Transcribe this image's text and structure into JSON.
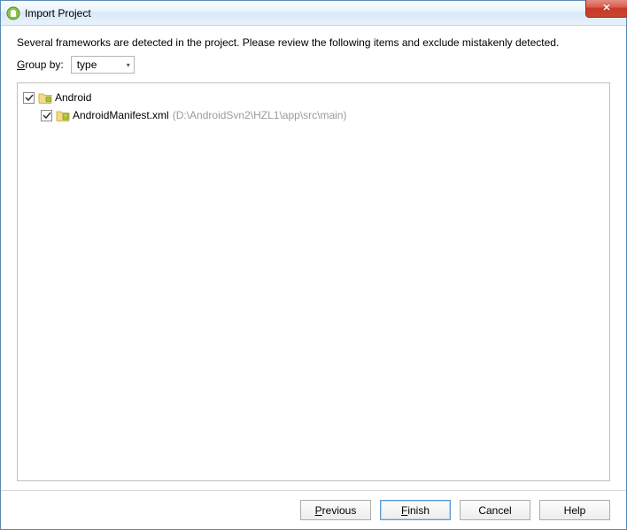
{
  "window": {
    "title": "Import Project"
  },
  "content": {
    "description": "Several frameworks are detected in the project. Please review the following items and exclude mistakenly detected.",
    "groupby_label_prefix": "",
    "groupby_label_mnemonic": "G",
    "groupby_label_suffix": "roup by:",
    "groupby_value": "type"
  },
  "tree": {
    "root": {
      "checked": true,
      "label": "Android"
    },
    "child": {
      "checked": true,
      "label": "AndroidManifest.xml",
      "path": "(D:\\AndroidSvn2\\HZL1\\app\\src\\main)"
    }
  },
  "buttons": {
    "previous_mn": "P",
    "previous_rest": "revious",
    "finish_mn": "F",
    "finish_rest": "inish",
    "cancel": "Cancel",
    "help": "Help"
  }
}
